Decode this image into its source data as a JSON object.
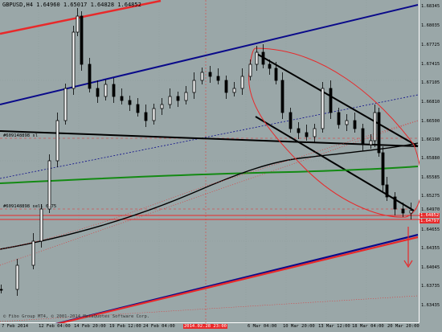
{
  "chart": {
    "symbol": "GBPUSD,H4",
    "ohlc": "1.64960 1.65017 1.64828 1.64852",
    "copyright": "© Fibo Group MT4, © 2001-2014 MetaQuotes Software Corp."
  },
  "price_axis": [
    {
      "label": "1.68345"
    },
    {
      "label": "1.68035"
    },
    {
      "label": "1.67725"
    },
    {
      "label": "1.67415"
    },
    {
      "label": "1.67105"
    },
    {
      "label": "1.66810"
    },
    {
      "label": "1.66500"
    },
    {
      "label": "1.66190"
    },
    {
      "label": "1.65880"
    },
    {
      "label": "1.65585"
    },
    {
      "label": "1.65275"
    },
    {
      "label": "1.64970"
    },
    {
      "label": "1.64655"
    },
    {
      "label": "1.64355"
    },
    {
      "label": "1.64045"
    },
    {
      "label": "1.63735"
    },
    {
      "label": "1.63435"
    }
  ],
  "time_axis": [
    {
      "label": "7 Feb 2014",
      "highlight": false
    },
    {
      "label": "12 Feb 04:00",
      "highlight": false
    },
    {
      "label": "14 Feb 20:00",
      "highlight": false
    },
    {
      "label": "19 Feb 12:00",
      "highlight": false
    },
    {
      "label": "24 Feb 04:00",
      "highlight": false
    },
    {
      "label": "2014.02.28 23:00",
      "highlight": true
    },
    {
      "label": "6 Mar 04:00",
      "highlight": false
    },
    {
      "label": "10 Mar 20:00",
      "highlight": false
    },
    {
      "label": "13 Mar 12:00",
      "highlight": false
    },
    {
      "label": "18 Mar 04:00",
      "highlight": false
    },
    {
      "label": "20 Mar 20:00",
      "highlight": false
    }
  ],
  "labels": {
    "line_a": "#609148898 sl",
    "line_b": "#609148898 sell 0.75",
    "current_price": "1.64852",
    "current_price2": "1.64797"
  },
  "colors": {
    "background": "#9aa7a8",
    "candle": "#000000",
    "channel_blue": "#0a0a8a",
    "channel_red": "#e8292a",
    "trend_black": "#000000",
    "ma_green": "#138a13",
    "ma_black": "#000000",
    "ellipse": "#e8292a"
  }
}
